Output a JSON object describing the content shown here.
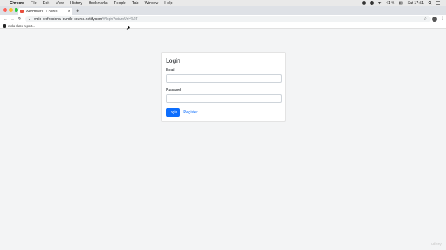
{
  "menubar": {
    "items": [
      "Chrome",
      "File",
      "Edit",
      "View",
      "History",
      "Bookmarks",
      "People",
      "Tab",
      "Window",
      "Help"
    ],
    "battery": "41 %",
    "clock": "Sat 17:51"
  },
  "browser": {
    "tab_title": "WebdriverIO Course",
    "url_host": "wdio-professional-bundle-course.netlify.com",
    "url_path": "/#/login?returnUrl=%2F",
    "bookmark_label": "wdio-slack-report..."
  },
  "login": {
    "title": "Login",
    "email_label": "Email",
    "email_value": "",
    "password_label": "Password",
    "password_value": "",
    "login_button": "Login",
    "register_link": "Register"
  },
  "watermark": "udemy",
  "colors": {
    "primary": "#0d6efd",
    "page_background": "#f3f4f5",
    "card_background": "#ffffff"
  }
}
